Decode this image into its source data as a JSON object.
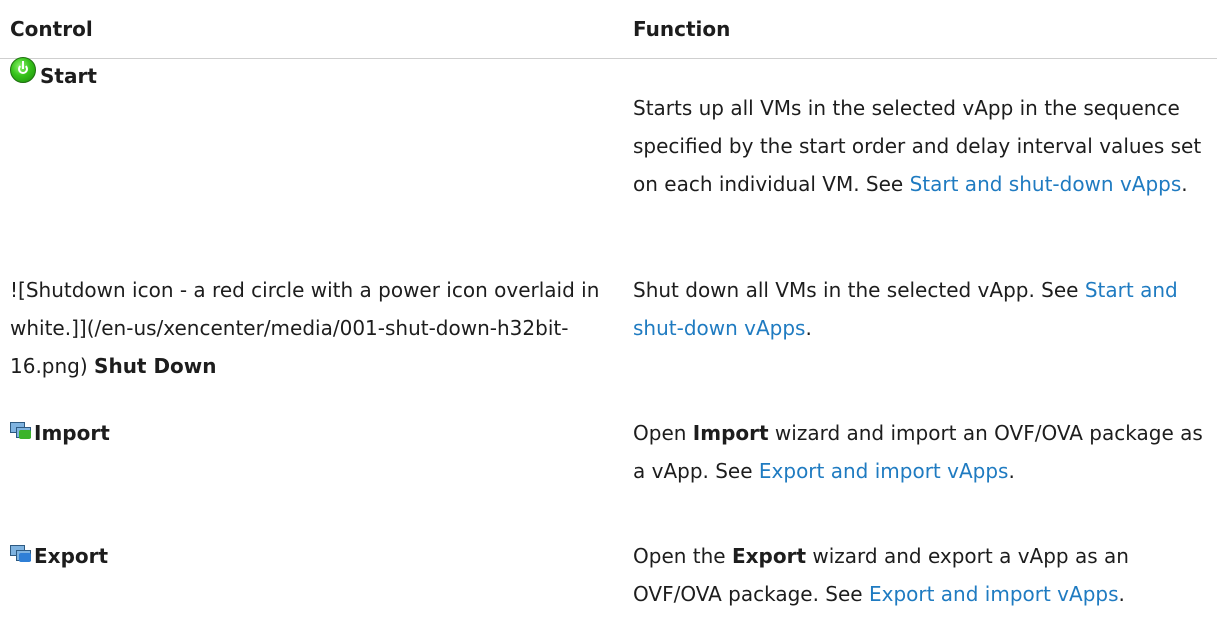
{
  "table": {
    "headers": {
      "control": "Control",
      "function": "Function"
    },
    "rows": [
      {
        "icon": "start-icon",
        "control_name": "Start",
        "description_before": "Starts up all VMs in the selected vApp in the sequence specified by the start order and delay interval values set on each individual VM. See ",
        "link": "Start and shut-down vApps",
        "description_after": "."
      },
      {
        "icon": "shutdown-icon",
        "control_raw": "![Shutdown icon - a red circle with a power icon overlaid in white.]](/en-us/xencenter/media/001-shut-down-h32bit-16.png) ",
        "control_name": "Shut Down",
        "description_before": "Shut down all VMs in the selected vApp. See ",
        "link": "Start and shut-down vApps",
        "description_after": "."
      },
      {
        "icon": "import-icon",
        "control_name": "Import",
        "description_prefix": "Open ",
        "description_bold": "Import",
        "description_before": " wizard and import an OVF/OVA package as a vApp. See ",
        "link": "Export and import vApps",
        "description_after": "."
      },
      {
        "icon": "export-icon",
        "control_name": "Export",
        "description_prefix": "Open the ",
        "description_bold": "Export",
        "description_before": " wizard and export a vApp as an OVF/OVA package. See ",
        "link": "Export and import vApps",
        "description_after": "."
      }
    ]
  },
  "colors": {
    "link": "#1f7bc1",
    "text": "#1d1d1d",
    "divider": "#cfcfcf",
    "start_icon": "#36c21a"
  }
}
